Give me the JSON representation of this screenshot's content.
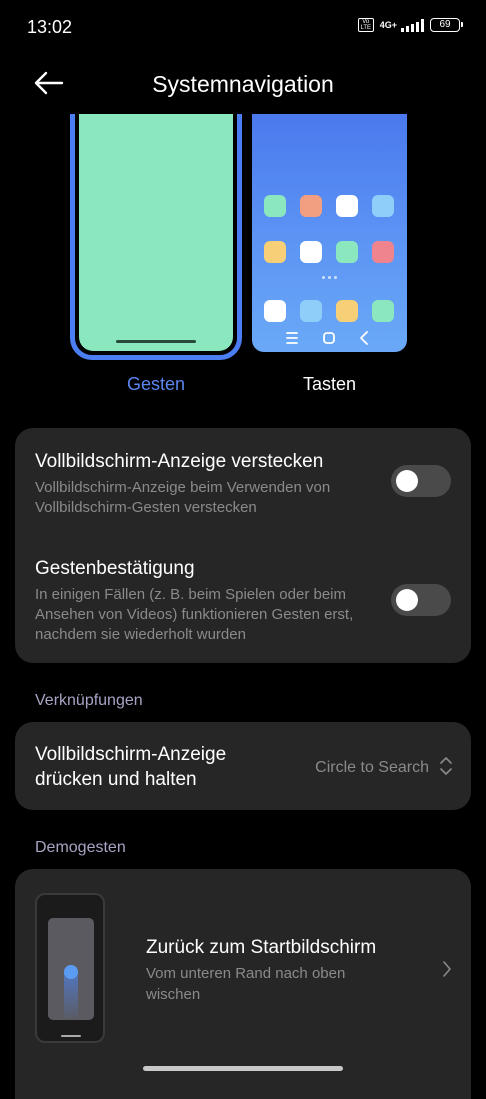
{
  "status_bar": {
    "time": "13:02",
    "volte_label": "Vo LTE",
    "network_label": "4G+",
    "battery_level": "69"
  },
  "header": {
    "title": "Systemnavigation",
    "back_icon": "arrow-left-icon"
  },
  "navigation_modes": {
    "selected": "Gesten",
    "gestures_label": "Gesten",
    "buttons_label": "Tasten",
    "accent_color": "#5b86f0",
    "gesture_preview_color": "#8be7bd"
  },
  "settings_card": {
    "items": [
      {
        "title": "Vollbildschirm-Anzeige verstecken",
        "description": "Vollbildschirm-Anzeige beim Verwenden von Vollbildschirm-Gesten verstecken",
        "enabled": false
      },
      {
        "title": "Gestenbestätigung",
        "description": "In einigen Fällen (z. B. beim Spielen oder beim Ansehen von Videos) funktionieren Gesten erst, nachdem sie wiederholt wurden",
        "enabled": false
      }
    ]
  },
  "shortcuts_section": {
    "header": "Verknüpfungen",
    "item": {
      "title_line1": "Vollbildschirm-Anzeige",
      "title_line2": "drücken und halten",
      "value": "Circle to Search",
      "icon": "chevron-up-down-icon"
    }
  },
  "demo_section": {
    "header": "Demogesten",
    "item": {
      "title": "Zurück zum Startbildschirm",
      "description_line1": "Vom unteren Rand nach oben",
      "description_line2": "wischen",
      "icon": "chevron-right-icon"
    }
  }
}
